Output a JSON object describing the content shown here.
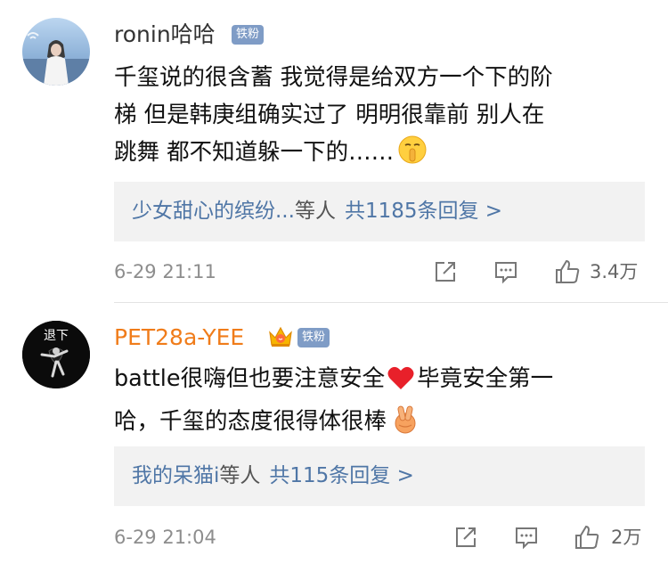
{
  "comments": [
    {
      "username": "ronin哈哈",
      "username_color": "#333333",
      "badge": "铁粉",
      "lines": [
        "千玺说的很含蓄  我觉得是给双方一个下的阶",
        "梯  但是韩庚组确实过了  明明很靠前  别人在",
        "跳舞  都不知道躲一下的……"
      ],
      "emoji": "shushing-face-emoji",
      "reply_names": "少女甜心的缤纷...",
      "reply_mid": "等人",
      "reply_count": "共1185条回复 >",
      "time": "6-29 21:11",
      "likes": "3.4万"
    },
    {
      "username": "PET28a-YEE",
      "username_color": "#f07c1a",
      "badge": "铁粉",
      "avatar_text": "退下",
      "line1_a": "battle很嗨但也要注意安全",
      "line1_b": "毕竟安全第一",
      "line2": "哈，千玺的态度很得体很棒",
      "emoji_heart": "red-heart-emoji",
      "emoji_hand": "victory-hand-emoji",
      "reply_names": "我的呆猫i",
      "reply_mid": "等人",
      "reply_count": "共115条回复 >",
      "time": "6-29 21:04",
      "likes": "2万"
    }
  ]
}
